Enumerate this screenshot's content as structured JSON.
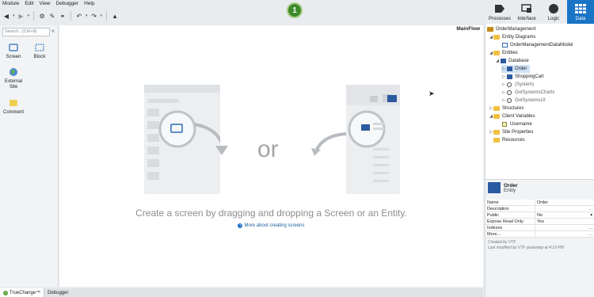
{
  "menu": [
    "Module",
    "Edit",
    "View",
    "Debugger",
    "Help"
  ],
  "badge": "1",
  "top_tabs": [
    {
      "label": "Processes",
      "icon": "processes-icon"
    },
    {
      "label": "Interface",
      "icon": "interface-icon"
    },
    {
      "label": "Logic",
      "icon": "logic-icon"
    },
    {
      "label": "Data",
      "icon": "data-icon"
    }
  ],
  "toolbox": {
    "search_placeholder": "Search...(Ctrl+8)",
    "tools": [
      "Screen",
      "Block",
      "External Site",
      "Comment"
    ]
  },
  "canvas": {
    "flow_name": "MainFlow",
    "or": "or",
    "hint": "Create a screen by dragging and dropping a Screen or an Entity.",
    "more_link": "More about creating screens"
  },
  "bottom_tabs": [
    "TrueChange™",
    "Debugger"
  ],
  "tree": {
    "root": "OrderManagement",
    "entity_diagrams": "Entity Diagrams",
    "data_model": "OrderManagementDataModel",
    "entities": "Entities",
    "database": "Database",
    "order": "Order",
    "shopping_cart": "ShoppingCart",
    "system": "(System)",
    "charts": "OutSystemsCharts",
    "ui": "OutSystemsUI",
    "structures": "Structures",
    "client_vars": "Client Variables",
    "username": "Username",
    "site_props": "Site Properties",
    "resources": "Resources"
  },
  "props": {
    "title": "Order",
    "subtitle": "Entity",
    "rows": [
      {
        "k": "Name",
        "v": "Order",
        "extra": ""
      },
      {
        "k": "Description",
        "v": "",
        "extra": "..."
      },
      {
        "k": "Public",
        "v": "No",
        "extra": "▾"
      },
      {
        "k": "Expose Read Only",
        "v": "Yes",
        "extra": ""
      },
      {
        "k": "Indexes",
        "v": "",
        "extra": "..."
      },
      {
        "k": "More...",
        "v": "",
        "extra": "..."
      }
    ],
    "created": "Created by VTF",
    "modified": "Last modified by VTF yesterday at 4:19 PM"
  },
  "colors": {
    "accent": "#1a74c6",
    "badge": "#3d8a2a"
  }
}
